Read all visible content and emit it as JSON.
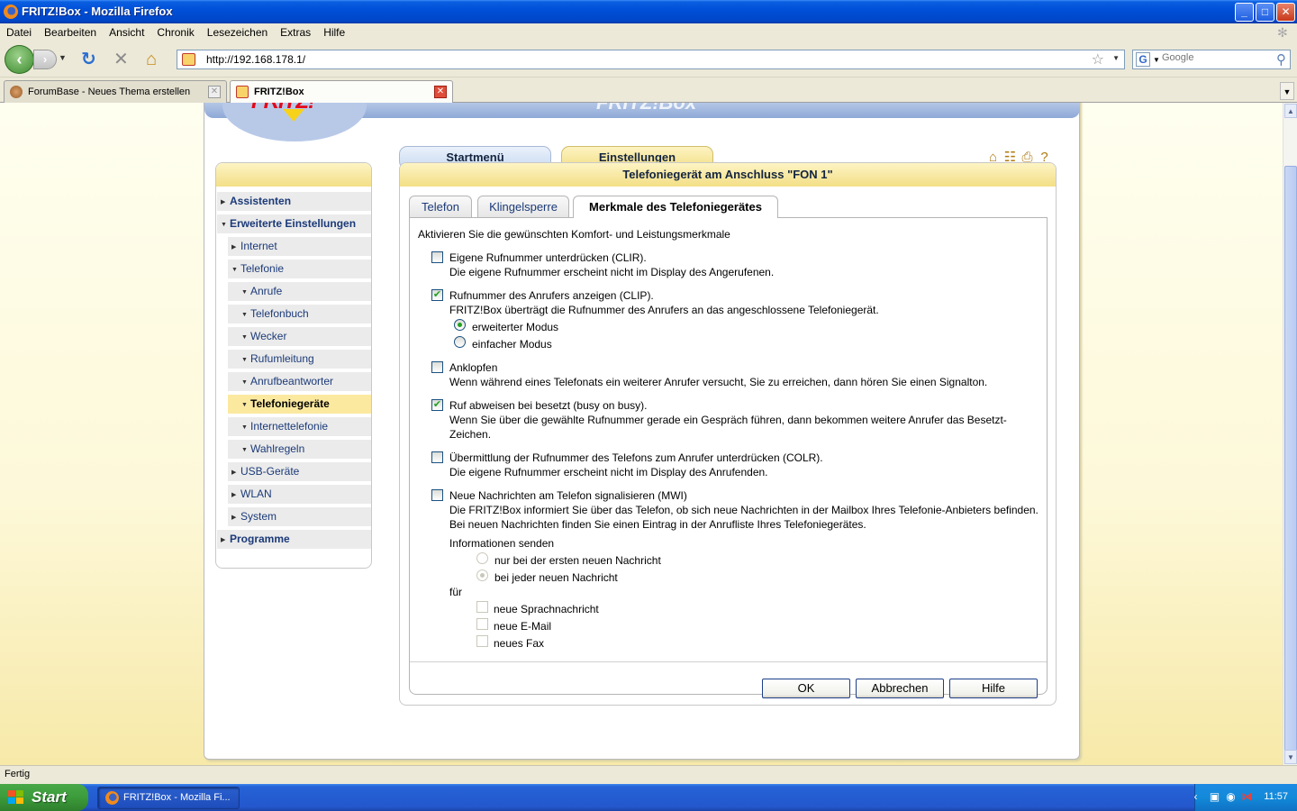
{
  "window": {
    "title": "FRITZ!Box - Mozilla Firefox",
    "minimize": "_",
    "maximize": "□",
    "close": "✕"
  },
  "menu": [
    "Datei",
    "Bearbeiten",
    "Ansicht",
    "Chronik",
    "Lesezeichen",
    "Extras",
    "Hilfe"
  ],
  "navigation": {
    "url": "http://192.168.178.1/",
    "search_placeholder": "Google"
  },
  "tabs": [
    {
      "label": "ForumBase - Neues Thema erstellen",
      "active": false
    },
    {
      "label": "FRITZ!Box",
      "active": true
    }
  ],
  "fritz": {
    "logo_text": "FRITZ!",
    "header_title": "FRITZ!Box",
    "main_tabs": {
      "start": "Startmenü",
      "settings": "Einstellungen"
    },
    "sidebar": [
      {
        "label": "Assistenten",
        "level": 0,
        "arrow": "▶"
      },
      {
        "label": "Erweiterte Einstellungen",
        "level": 0,
        "arrow": "▼"
      },
      {
        "label": "Internet",
        "level": 1,
        "arrow": "▶"
      },
      {
        "label": "Telefonie",
        "level": 1,
        "arrow": "▼"
      },
      {
        "label": "Anrufe",
        "level": 2,
        "arrow": "▼"
      },
      {
        "label": "Telefonbuch",
        "level": 2,
        "arrow": "▼"
      },
      {
        "label": "Wecker",
        "level": 2,
        "arrow": "▼"
      },
      {
        "label": "Rufumleitung",
        "level": 2,
        "arrow": "▼"
      },
      {
        "label": "Anrufbeantworter",
        "level": 2,
        "arrow": "▼"
      },
      {
        "label": "Telefoniegeräte",
        "level": 2,
        "arrow": "▼",
        "active": true
      },
      {
        "label": "Internettelefonie",
        "level": 2,
        "arrow": "▼"
      },
      {
        "label": "Wahlregeln",
        "level": 2,
        "arrow": "▼"
      },
      {
        "label": "USB-Geräte",
        "level": 1,
        "arrow": "▶"
      },
      {
        "label": "WLAN",
        "level": 1,
        "arrow": "▶"
      },
      {
        "label": "System",
        "level": 1,
        "arrow": "▶"
      },
      {
        "label": "Programme",
        "level": 0,
        "arrow": "▶"
      }
    ],
    "panel_title": "Telefoniegerät am Anschluss \"FON 1\"",
    "subtabs": [
      "Telefon",
      "Klingelsperre",
      "Merkmale des Telefoniegerätes"
    ],
    "intro": "Aktivieren Sie die gewünschten Komfort- und Leistungsmerkmale",
    "features": {
      "clir": {
        "label": "Eigene Rufnummer unterdrücken (CLIR).",
        "desc": "Die eigene Rufnummer erscheint nicht im Display des Angerufenen.",
        "checked": false
      },
      "clip": {
        "label": "Rufnummer des Anrufers anzeigen (CLIP).",
        "desc": "FRITZ!Box überträgt die Rufnummer des Anrufers an das angeschlossene Telefoniegerät.",
        "checked": true,
        "modes": [
          {
            "label": "erweiterter Modus",
            "selected": true
          },
          {
            "label": "einfacher Modus",
            "selected": false
          }
        ]
      },
      "knock": {
        "label": "Anklopfen",
        "desc": "Wenn während eines Telefonats ein weiterer Anrufer versucht, Sie zu erreichen, dann hören Sie einen Signalton.",
        "checked": false
      },
      "busy": {
        "label": "Ruf abweisen bei besetzt (busy on busy).",
        "desc": "Wenn Sie über die gewählte Rufnummer gerade ein Gespräch führen, dann bekommen weitere Anrufer das Besetzt-Zeichen.",
        "checked": true
      },
      "colr": {
        "label": "Übermittlung der Rufnummer des Telefons zum Anrufer unterdrücken (COLR).",
        "desc": "Die eigene Rufnummer erscheint nicht im Display des Anrufenden.",
        "checked": false
      },
      "mwi": {
        "label": "Neue Nachrichten am Telefon signalisieren (MWI)",
        "desc": "Die FRITZ!Box informiert Sie über das Telefon, ob sich neue Nachrichten in der Mailbox Ihres Telefonie-Anbieters befinden. Bei neuen Nachrichten finden Sie einen Eintrag in der Anrufliste Ihres Telefoniegerätes.",
        "checked": false,
        "send_label": "Informationen senden",
        "send_options": [
          {
            "label": "nur bei der ersten neuen Nachricht",
            "selected": false
          },
          {
            "label": "bei jeder neuen Nachricht",
            "selected": true
          }
        ],
        "for_label": "für",
        "for_options": [
          {
            "label": "neue Sprachnachricht"
          },
          {
            "label": "neue E-Mail"
          },
          {
            "label": "neues Fax"
          }
        ]
      }
    },
    "buttons": {
      "ok": "OK",
      "cancel": "Abbrechen",
      "help": "Hilfe"
    }
  },
  "status": "Fertig",
  "taskbar": {
    "start": "Start",
    "item": "FRITZ!Box - Mozilla Fi...",
    "clock": "11:57"
  }
}
